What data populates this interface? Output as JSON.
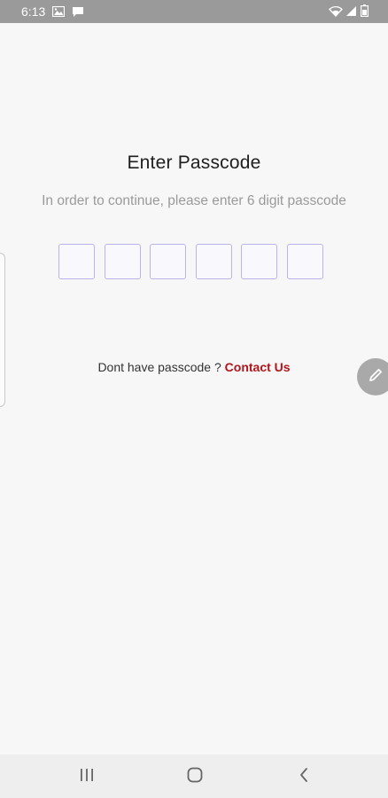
{
  "status_bar": {
    "time": "6:13",
    "left_icons": [
      "gallery-icon",
      "message-icon"
    ],
    "right_icons": [
      "wifi-icon",
      "signal-icon",
      "battery-icon"
    ]
  },
  "passcode": {
    "title": "Enter Passcode",
    "subtitle": "In order to continue, please enter 6 digit passcode",
    "digit_count": 6,
    "digits": [
      "",
      "",
      "",
      "",
      "",
      ""
    ]
  },
  "help": {
    "prompt": "Dont have passcode ?",
    "link_label": "Contact Us",
    "link_color": "#b0151c"
  },
  "floating": {
    "edit_icon": "pencil-icon"
  },
  "nav_bar": {
    "items": [
      "recents-icon",
      "home-icon",
      "back-icon"
    ]
  },
  "colors": {
    "background": "#f7f7f7",
    "status_bar": "#9a9a9a",
    "box_border": "#b9b4ea",
    "accent": "#b0151c"
  }
}
